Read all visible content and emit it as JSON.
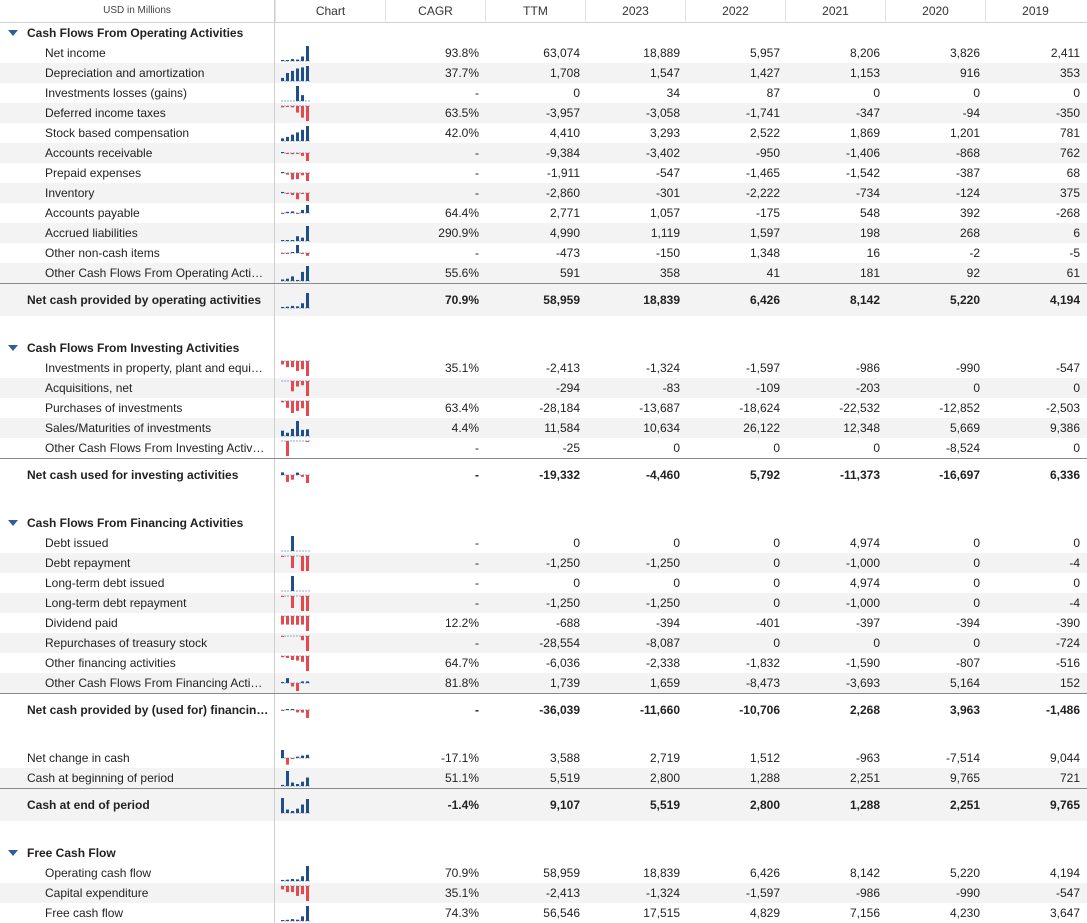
{
  "header": {
    "units": "USD in Millions",
    "chart": "Chart",
    "cagr": "CAGR",
    "cols": [
      "TTM",
      "2023",
      "2022",
      "2021",
      "2020",
      "2019"
    ]
  },
  "colors": {
    "positive": "#1f4e8c",
    "negative": "#e8484c",
    "dash": "#6a8fbd"
  },
  "rows": [
    {
      "kind": "section",
      "label": "Cash Flows From Operating Activities"
    },
    {
      "kind": "item",
      "label": "Net income",
      "cagr": "93.8%",
      "vals": [
        "63,074",
        "18,889",
        "5,957",
        "8,206",
        "3,826",
        "2,411"
      ],
      "spark": [
        2411,
        3826,
        8206,
        5957,
        18889,
        63074
      ]
    },
    {
      "kind": "item",
      "label": "Depreciation and amortization",
      "cagr": "37.7%",
      "vals": [
        "1,708",
        "1,547",
        "1,427",
        "1,153",
        "916",
        "353"
      ],
      "spark": [
        353,
        916,
        1153,
        1427,
        1547,
        1708
      ]
    },
    {
      "kind": "item",
      "label": "Investments losses (gains)",
      "cagr": "-",
      "vals": [
        "0",
        "34",
        "87",
        "0",
        "0",
        "0"
      ],
      "spark": [
        0,
        0,
        0,
        87,
        34,
        0
      ]
    },
    {
      "kind": "item",
      "label": "Deferred income taxes",
      "cagr": "63.5%",
      "vals": [
        "-3,957",
        "-3,058",
        "-1,741",
        "-347",
        "-94",
        "-350"
      ],
      "spark": [
        -350,
        -94,
        -347,
        -1741,
        -3058,
        -3957
      ]
    },
    {
      "kind": "item",
      "label": "Stock based compensation",
      "cagr": "42.0%",
      "vals": [
        "4,410",
        "3,293",
        "2,522",
        "1,869",
        "1,201",
        "781"
      ],
      "spark": [
        781,
        1201,
        1869,
        2522,
        3293,
        4410
      ]
    },
    {
      "kind": "item",
      "label": "Accounts receivable",
      "cagr": "-",
      "vals": [
        "-9,384",
        "-3,402",
        "-950",
        "-1,406",
        "-868",
        "762"
      ],
      "spark": [
        762,
        -868,
        -1406,
        -950,
        -3402,
        -9384
      ]
    },
    {
      "kind": "item",
      "label": "Prepaid expenses",
      "cagr": "-",
      "vals": [
        "-1,911",
        "-547",
        "-1,465",
        "-1,542",
        "-387",
        "68"
      ],
      "spark": [
        68,
        -387,
        -1542,
        -1465,
        -547,
        -1911
      ]
    },
    {
      "kind": "item",
      "label": "Inventory",
      "cagr": "-",
      "vals": [
        "-2,860",
        "-301",
        "-2,222",
        "-734",
        "-124",
        "375"
      ],
      "spark": [
        375,
        -124,
        -734,
        -2222,
        -301,
        -2860
      ]
    },
    {
      "kind": "item",
      "label": "Accounts payable",
      "cagr": "64.4%",
      "vals": [
        "2,771",
        "1,057",
        "-175",
        "548",
        "392",
        "-268"
      ],
      "spark": [
        -268,
        392,
        548,
        -175,
        1057,
        2771
      ]
    },
    {
      "kind": "item",
      "label": "Accrued liabilities",
      "cagr": "290.9%",
      "vals": [
        "4,990",
        "1,119",
        "1,597",
        "198",
        "268",
        "6"
      ],
      "spark": [
        6,
        268,
        198,
        1597,
        1119,
        4990
      ]
    },
    {
      "kind": "item",
      "label": "Other non-cash items",
      "cagr": "-",
      "vals": [
        "-473",
        "-150",
        "1,348",
        "16",
        "-2",
        "-5"
      ],
      "spark": [
        -5,
        -2,
        16,
        1348,
        -150,
        -473
      ]
    },
    {
      "kind": "item",
      "label": "Other Cash Flows From Operating Acti…",
      "cagr": "55.6%",
      "vals": [
        "591",
        "358",
        "41",
        "181",
        "92",
        "61"
      ],
      "spark": [
        61,
        92,
        181,
        41,
        358,
        591
      ]
    },
    {
      "kind": "total",
      "label": "Net cash provided by operating activities",
      "cagr": "70.9%",
      "vals": [
        "58,959",
        "18,839",
        "6,426",
        "8,142",
        "5,220",
        "4,194"
      ],
      "spark": [
        4194,
        5220,
        8142,
        6426,
        18839,
        58959
      ]
    },
    {
      "kind": "spacer",
      "tall": true
    },
    {
      "kind": "section",
      "label": "Cash Flows From Investing Activities"
    },
    {
      "kind": "item",
      "label": "Investments in property, plant and equi…",
      "cagr": "35.1%",
      "vals": [
        "-2,413",
        "-1,324",
        "-1,597",
        "-986",
        "-990",
        "-547"
      ],
      "spark": [
        -547,
        -990,
        -986,
        -1597,
        -1324,
        -2413
      ]
    },
    {
      "kind": "item",
      "label": "Acquisitions, net",
      "cagr": "",
      "vals": [
        "-294",
        "-83",
        "-109",
        "-203",
        "0",
        "0"
      ],
      "spark": [
        0,
        0,
        -203,
        -109,
        -83,
        -294
      ]
    },
    {
      "kind": "item",
      "label": "Purchases of investments",
      "cagr": "63.4%",
      "vals": [
        "-28,184",
        "-13,687",
        "-18,624",
        "-22,532",
        "-12,852",
        "-2,503"
      ],
      "spark": [
        -2503,
        -12852,
        -22532,
        -18624,
        -13687,
        -28184
      ]
    },
    {
      "kind": "item",
      "label": "Sales/Maturities of investments",
      "cagr": "4.4%",
      "vals": [
        "11,584",
        "10,634",
        "26,122",
        "12,348",
        "5,669",
        "9,386"
      ],
      "spark": [
        9386,
        5669,
        12348,
        26122,
        10634,
        11584
      ]
    },
    {
      "kind": "item",
      "label": "Other Cash Flows From Investing Activ…",
      "cagr": "-",
      "vals": [
        "-25",
        "0",
        "0",
        "0",
        "-8,524",
        "0"
      ],
      "spark": [
        0,
        -8524,
        0,
        0,
        0,
        -25
      ]
    },
    {
      "kind": "total",
      "label": "Net cash used for investing activities",
      "cagr": "-",
      "vals": [
        "-19,332",
        "-4,460",
        "5,792",
        "-11,373",
        "-16,697",
        "6,336"
      ],
      "spark": [
        6336,
        -16697,
        -11373,
        5792,
        -4460,
        -19332
      ],
      "nobg": true
    },
    {
      "kind": "spacer",
      "tall": true
    },
    {
      "kind": "section",
      "label": "Cash Flows From Financing Activities"
    },
    {
      "kind": "item",
      "label": "Debt issued",
      "cagr": "-",
      "vals": [
        "0",
        "0",
        "0",
        "4,974",
        "0",
        "0"
      ],
      "spark": [
        0,
        0,
        4974,
        0,
        0,
        0
      ]
    },
    {
      "kind": "item",
      "label": "Debt repayment",
      "cagr": "-",
      "vals": [
        "-1,250",
        "-1,250",
        "0",
        "-1,000",
        "0",
        "-4"
      ],
      "spark": [
        -4,
        0,
        -1000,
        0,
        -1250,
        -1250
      ]
    },
    {
      "kind": "item",
      "label": "Long-term debt issued",
      "cagr": "-",
      "vals": [
        "0",
        "0",
        "0",
        "4,974",
        "0",
        "0"
      ],
      "spark": [
        0,
        0,
        4974,
        0,
        0,
        0
      ]
    },
    {
      "kind": "item",
      "label": "Long-term debt repayment",
      "cagr": "-",
      "vals": [
        "-1,250",
        "-1,250",
        "0",
        "-1,000",
        "0",
        "-4"
      ],
      "spark": [
        -4,
        0,
        -1000,
        0,
        -1250,
        -1250
      ]
    },
    {
      "kind": "item",
      "label": "Dividend paid",
      "cagr": "12.2%",
      "vals": [
        "-688",
        "-394",
        "-401",
        "-397",
        "-394",
        "-390"
      ],
      "spark": [
        -390,
        -394,
        -397,
        -401,
        -394,
        -688
      ]
    },
    {
      "kind": "item",
      "label": "Repurchases of treasury stock",
      "cagr": "-",
      "vals": [
        "-28,554",
        "-8,087",
        "0",
        "0",
        "0",
        "-724"
      ],
      "spark": [
        -724,
        0,
        0,
        0,
        -8087,
        -28554
      ]
    },
    {
      "kind": "item",
      "label": "Other financing activities",
      "cagr": "64.7%",
      "vals": [
        "-6,036",
        "-2,338",
        "-1,832",
        "-1,590",
        "-807",
        "-516"
      ],
      "spark": [
        -516,
        -807,
        -1590,
        -1832,
        -2338,
        -6036
      ]
    },
    {
      "kind": "item",
      "label": "Other Cash Flows From Financing Acti…",
      "cagr": "81.8%",
      "vals": [
        "1,739",
        "1,659",
        "-8,473",
        "-3,693",
        "5,164",
        "152"
      ],
      "spark": [
        152,
        5164,
        -3693,
        -8473,
        1659,
        1739
      ]
    },
    {
      "kind": "total",
      "label": "Net cash provided by (used for) financin…",
      "cagr": "-",
      "vals": [
        "-36,039",
        "-11,660",
        "-10,706",
        "2,268",
        "3,963",
        "-1,486"
      ],
      "spark": [
        -1486,
        3963,
        2268,
        -10706,
        -11660,
        -36039
      ],
      "nobg": true
    },
    {
      "kind": "spacer",
      "tall": true
    },
    {
      "kind": "item",
      "label": "Net change in cash",
      "cagr": "-17.1%",
      "vals": [
        "3,588",
        "2,719",
        "1,512",
        "-963",
        "-7,514",
        "9,044"
      ],
      "spark": [
        9044,
        -7514,
        -963,
        1512,
        2719,
        3588
      ],
      "indent": "small"
    },
    {
      "kind": "item",
      "label": "Cash at beginning of period",
      "cagr": "51.1%",
      "vals": [
        "5,519",
        "2,800",
        "1,288",
        "2,251",
        "9,765",
        "721"
      ],
      "spark": [
        721,
        9765,
        2251,
        1288,
        2800,
        5519
      ],
      "indent": "small"
    },
    {
      "kind": "total",
      "label": "Cash at end of period",
      "cagr": "-1.4%",
      "vals": [
        "9,107",
        "5,519",
        "2,800",
        "1,288",
        "2,251",
        "9,765"
      ],
      "spark": [
        9765,
        2251,
        1288,
        2800,
        5519,
        9107
      ]
    },
    {
      "kind": "spacer",
      "tall": true
    },
    {
      "kind": "section",
      "label": "Free Cash Flow"
    },
    {
      "kind": "item",
      "label": "Operating cash flow",
      "cagr": "70.9%",
      "vals": [
        "58,959",
        "18,839",
        "6,426",
        "8,142",
        "5,220",
        "4,194"
      ],
      "spark": [
        4194,
        5220,
        8142,
        6426,
        18839,
        58959
      ]
    },
    {
      "kind": "item",
      "label": "Capital expenditure",
      "cagr": "35.1%",
      "vals": [
        "-2,413",
        "-1,324",
        "-1,597",
        "-986",
        "-990",
        "-547"
      ],
      "spark": [
        -547,
        -990,
        -986,
        -1597,
        -1324,
        -2413
      ]
    },
    {
      "kind": "item",
      "label": "Free cash flow",
      "cagr": "74.3%",
      "vals": [
        "56,546",
        "17,515",
        "4,829",
        "7,156",
        "4,230",
        "3,647"
      ],
      "spark": [
        3647,
        4230,
        7156,
        4829,
        17515,
        56546
      ]
    }
  ]
}
